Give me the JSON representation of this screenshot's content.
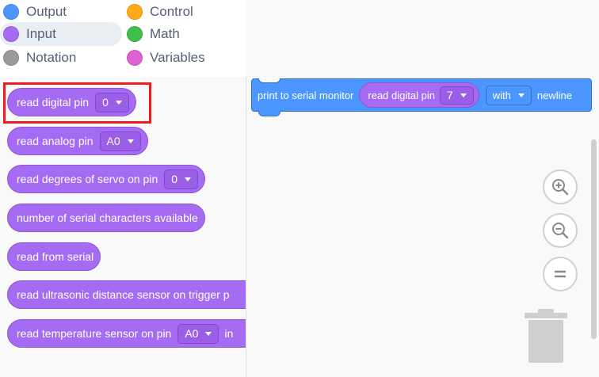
{
  "categories": [
    {
      "label": "Output",
      "color": "#4c97ff",
      "selected": false
    },
    {
      "label": "Control",
      "color": "#ffab19",
      "selected": false
    },
    {
      "label": "Input",
      "color": "#a56bf2",
      "selected": true
    },
    {
      "label": "Math",
      "color": "#40bf4a",
      "selected": false
    },
    {
      "label": "Notation",
      "color": "#9a9a9a",
      "selected": false
    },
    {
      "label": "Variables",
      "color": "#df62d3",
      "selected": false
    }
  ],
  "flyout": {
    "read_digital": {
      "label": "read digital pin",
      "value": "0"
    },
    "read_analog": {
      "label": "read analog pin",
      "value": "A0"
    },
    "servo": {
      "label": "read degrees of servo on pin",
      "value": "0"
    },
    "serial_count": {
      "label": "number of serial characters available"
    },
    "read_serial": {
      "label": "read from serial"
    },
    "ultrasonic": {
      "label": "read ultrasonic distance sensor on trigger p"
    },
    "temperature": {
      "label": "read temperature sensor on pin",
      "value": "A0",
      "suffix": "in"
    }
  },
  "workspace": {
    "print_label": "print to serial monitor",
    "inner_label": "read digital pin",
    "inner_value": "7",
    "with_value": "with",
    "newline_label": "newline"
  },
  "icons": {
    "zoom_in": "zoom-in-icon",
    "zoom_out": "zoom-out-icon",
    "zoom_reset": "zoom-reset-icon",
    "trash": "trash-icon"
  },
  "colors": {
    "input_block": "#a56bf2",
    "output_block": "#4c97ff",
    "highlight": "#ee1c1c"
  }
}
